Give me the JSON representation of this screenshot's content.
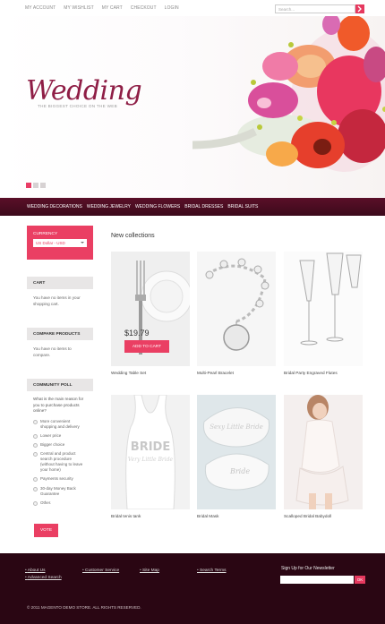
{
  "top_links": [
    "MY ACCOUNT",
    "MY WISHLIST",
    "MY CART",
    "CHECKOUT",
    "LOGIN"
  ],
  "logo": {
    "title": "Wedding",
    "subtitle": "THE BIGGEST CHOICE ON THE WEB"
  },
  "slider": {
    "dots": 3,
    "active": 1
  },
  "nav": [
    "WEDDING DECORATIONS",
    "WEDDING JEWELRY",
    "WEDDING FLOWERS",
    "BRIDAL DRESSES",
    "BRIDAL SUITS"
  ],
  "search": {
    "placeholder": "Search..."
  },
  "sidebar": {
    "currency": {
      "title": "CURRENCY",
      "selected": "US Dollar - USD"
    },
    "cart": {
      "title": "CART",
      "text": "You have no items in your shopping cart."
    },
    "compare": {
      "title": "COMPARE PRODUCTS",
      "text": "You have no items to compare."
    },
    "poll": {
      "title": "COMMUNITY POLL",
      "question": "What is the main reason for you to purchase products online?",
      "options": [
        "More convenient shopping and delivery",
        "Lower price",
        "Bigger choice",
        "Central and product search procedure (without having to leave your home)",
        "Payments security",
        "30-day Money Back Guarantee",
        "Other."
      ],
      "vote": "VOTE"
    }
  },
  "main": {
    "title": "New collections",
    "products": [
      {
        "name": "Wedding Table Set",
        "price": "$19.79",
        "button": "ADD TO CART"
      },
      {
        "name": "Multi-Pearl Bracelet"
      },
      {
        "name": "Bridal Party Engraved Flutes"
      },
      {
        "name": "Bridal tenis tank"
      },
      {
        "name": "Bridal Mask"
      },
      {
        "name": "Scalloped Bridal Babydoll"
      }
    ]
  },
  "footer": {
    "col1": [
      "About Us",
      "Advanced Search"
    ],
    "col2": [
      "Customer Service"
    ],
    "col3": [
      "Site Map"
    ],
    "col4": [
      "Search Terms"
    ],
    "newsletter": {
      "title": "Sign Up for Our Newsletter",
      "button": "OK"
    },
    "copyright": "© 2011 MAGENTO DEMO STORE. ALL RIGHTS RESERVED."
  },
  "colors": {
    "accent": "#ea3f63",
    "nav": "#4a0c20",
    "footer": "#2a0613",
    "logo": "#8f1e46"
  }
}
